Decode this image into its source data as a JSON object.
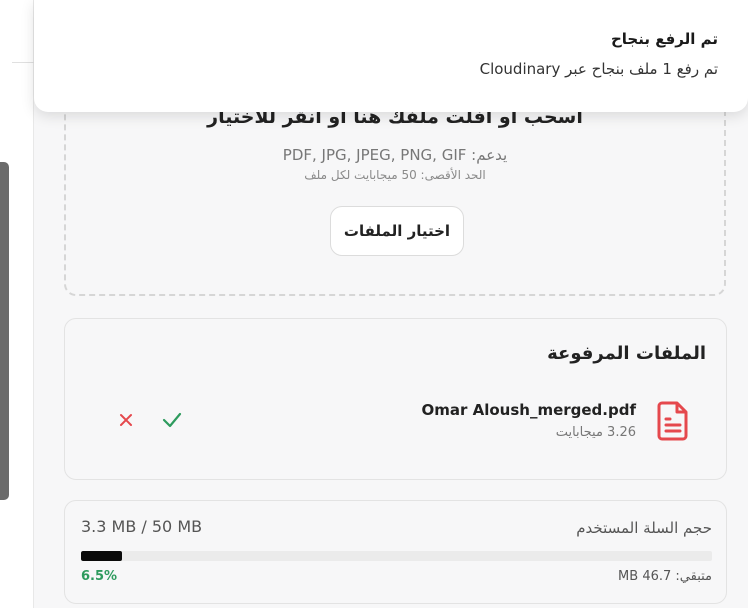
{
  "toast": {
    "title": "تم الرفع بنجاح",
    "message": "تم رفع 1 ملف بنجاح عبر Cloudinary"
  },
  "dropzone": {
    "title": "اسحب أو أفلت ملفك هنا أو انقر للاختيار",
    "supported": "يدعم: PDF, JPG, JPEG, PNG, GIF",
    "max_size": "الحد الأقصى: 50 ميجابايت لكل ملف",
    "choose_button": "اختيار الملفات"
  },
  "uploaded_files": {
    "title": "الملفات المرفوعة",
    "items": [
      {
        "name": "Omar Aloush_merged.pdf",
        "size": "3.26 ميجابايت",
        "icon": "file-text-icon"
      }
    ]
  },
  "storage": {
    "label": "حجم السلة المستخدم",
    "used": "3.3 MB / 50 MB",
    "percent_label": "6.5%",
    "percent_value": 0.065,
    "remaining": "متبقي: 46.7 MB"
  },
  "colors": {
    "file_icon": "#e5484d",
    "check": "#2e9b5e",
    "remove": "#e5484d",
    "progress": "#0a0a0a",
    "percent": "#2e9b5e"
  }
}
